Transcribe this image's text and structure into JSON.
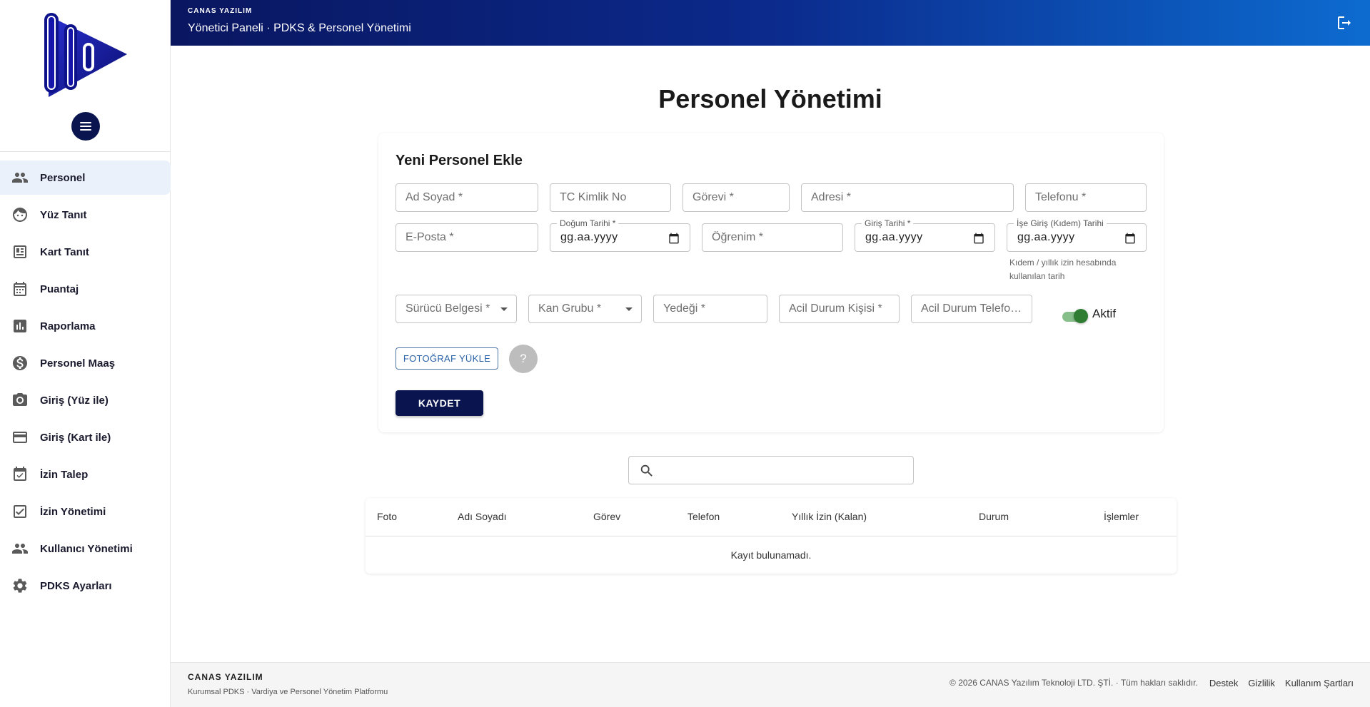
{
  "header": {
    "brand": "CANAS YAZILIM",
    "title": "Yönetici Paneli · PDKS & Personel Yönetimi"
  },
  "sidebar": {
    "items": [
      {
        "label": "Personel",
        "icon": "people-icon"
      },
      {
        "label": "Yüz Tanıt",
        "icon": "face-icon"
      },
      {
        "label": "Kart Tanıt",
        "icon": "badge-icon"
      },
      {
        "label": "Puantaj",
        "icon": "calendar-icon"
      },
      {
        "label": "Raporlama",
        "icon": "bar-chart-icon"
      },
      {
        "label": "Personel Maaş",
        "icon": "dollar-icon"
      },
      {
        "label": "Giriş (Yüz ile)",
        "icon": "camera-icon"
      },
      {
        "label": "Giriş (Kart ile)",
        "icon": "credit-card-icon"
      },
      {
        "label": "İzin Talep",
        "icon": "event-available-icon"
      },
      {
        "label": "İzin Yönetimi",
        "icon": "checklist-icon"
      },
      {
        "label": "Kullanıcı Yönetimi",
        "icon": "people-icon"
      },
      {
        "label": "PDKS Ayarları",
        "icon": "gear-icon"
      }
    ]
  },
  "main": {
    "page_title": "Personel Yönetimi",
    "form": {
      "title": "Yeni Personel Ekle",
      "ad_soyad": "Ad Soyad *",
      "tc_kimlik": "TC Kimlik No",
      "gorevi": "Görevi *",
      "adresi": "Adresi *",
      "telefonu": "Telefonu *",
      "eposta": "E-Posta *",
      "dogum_tarihi_label": "Doğum Tarihi *",
      "dogum_tarihi_value": "gg.aa.yyyy",
      "ogrenim": "Öğrenim *",
      "giris_tarihi_label": "Giriş Tarihi *",
      "giris_tarihi_value": "gg.aa.yyyy",
      "kidem_label": "İşe Giriş (Kıdem) Tarihi",
      "kidem_value": "gg.aa.yyyy",
      "kidem_helper": "Kıdem / yıllık izin hesabında kullanılan tarih",
      "surucu_belgesi": "Sürücü Belgesi *",
      "kan_grubu": "Kan Grubu *",
      "yedegi": "Yedeği *",
      "acil_kisi": "Acil Durum Kişisi *",
      "acil_telefon": "Acil Durum Telefonu *",
      "aktif_label": "Aktif",
      "upload_label": "FOTOĞRAF YÜKLE",
      "avatar_placeholder": "?",
      "save_label": "KAYDET"
    },
    "search": {
      "placeholder": ""
    },
    "table": {
      "columns": [
        "Foto",
        "Adı Soyadı",
        "Görev",
        "Telefon",
        "Yıllık İzin (Kalan)",
        "Durum",
        "İşlemler"
      ],
      "empty_text": "Kayıt bulunamadı."
    }
  },
  "footer": {
    "brand": "CANAS YAZILIM",
    "tagline": "Kurumsal PDKS · Vardiya ve Personel Yönetim Platformu",
    "copyright": "© 2026 CANAS Yazılım Teknoloji LTD. ŞTİ. · Tüm hakları saklıdır.",
    "links": [
      "Destek",
      "Gizlilik",
      "Kullanım Şartları"
    ]
  },
  "colors": {
    "primary_navy": "#0a1550",
    "header_gradient_start": "#0a1660",
    "header_gradient_end": "#0d6bd0",
    "active_nav_bg": "#eaf1fb",
    "toggle_green": "#2e7d32"
  }
}
